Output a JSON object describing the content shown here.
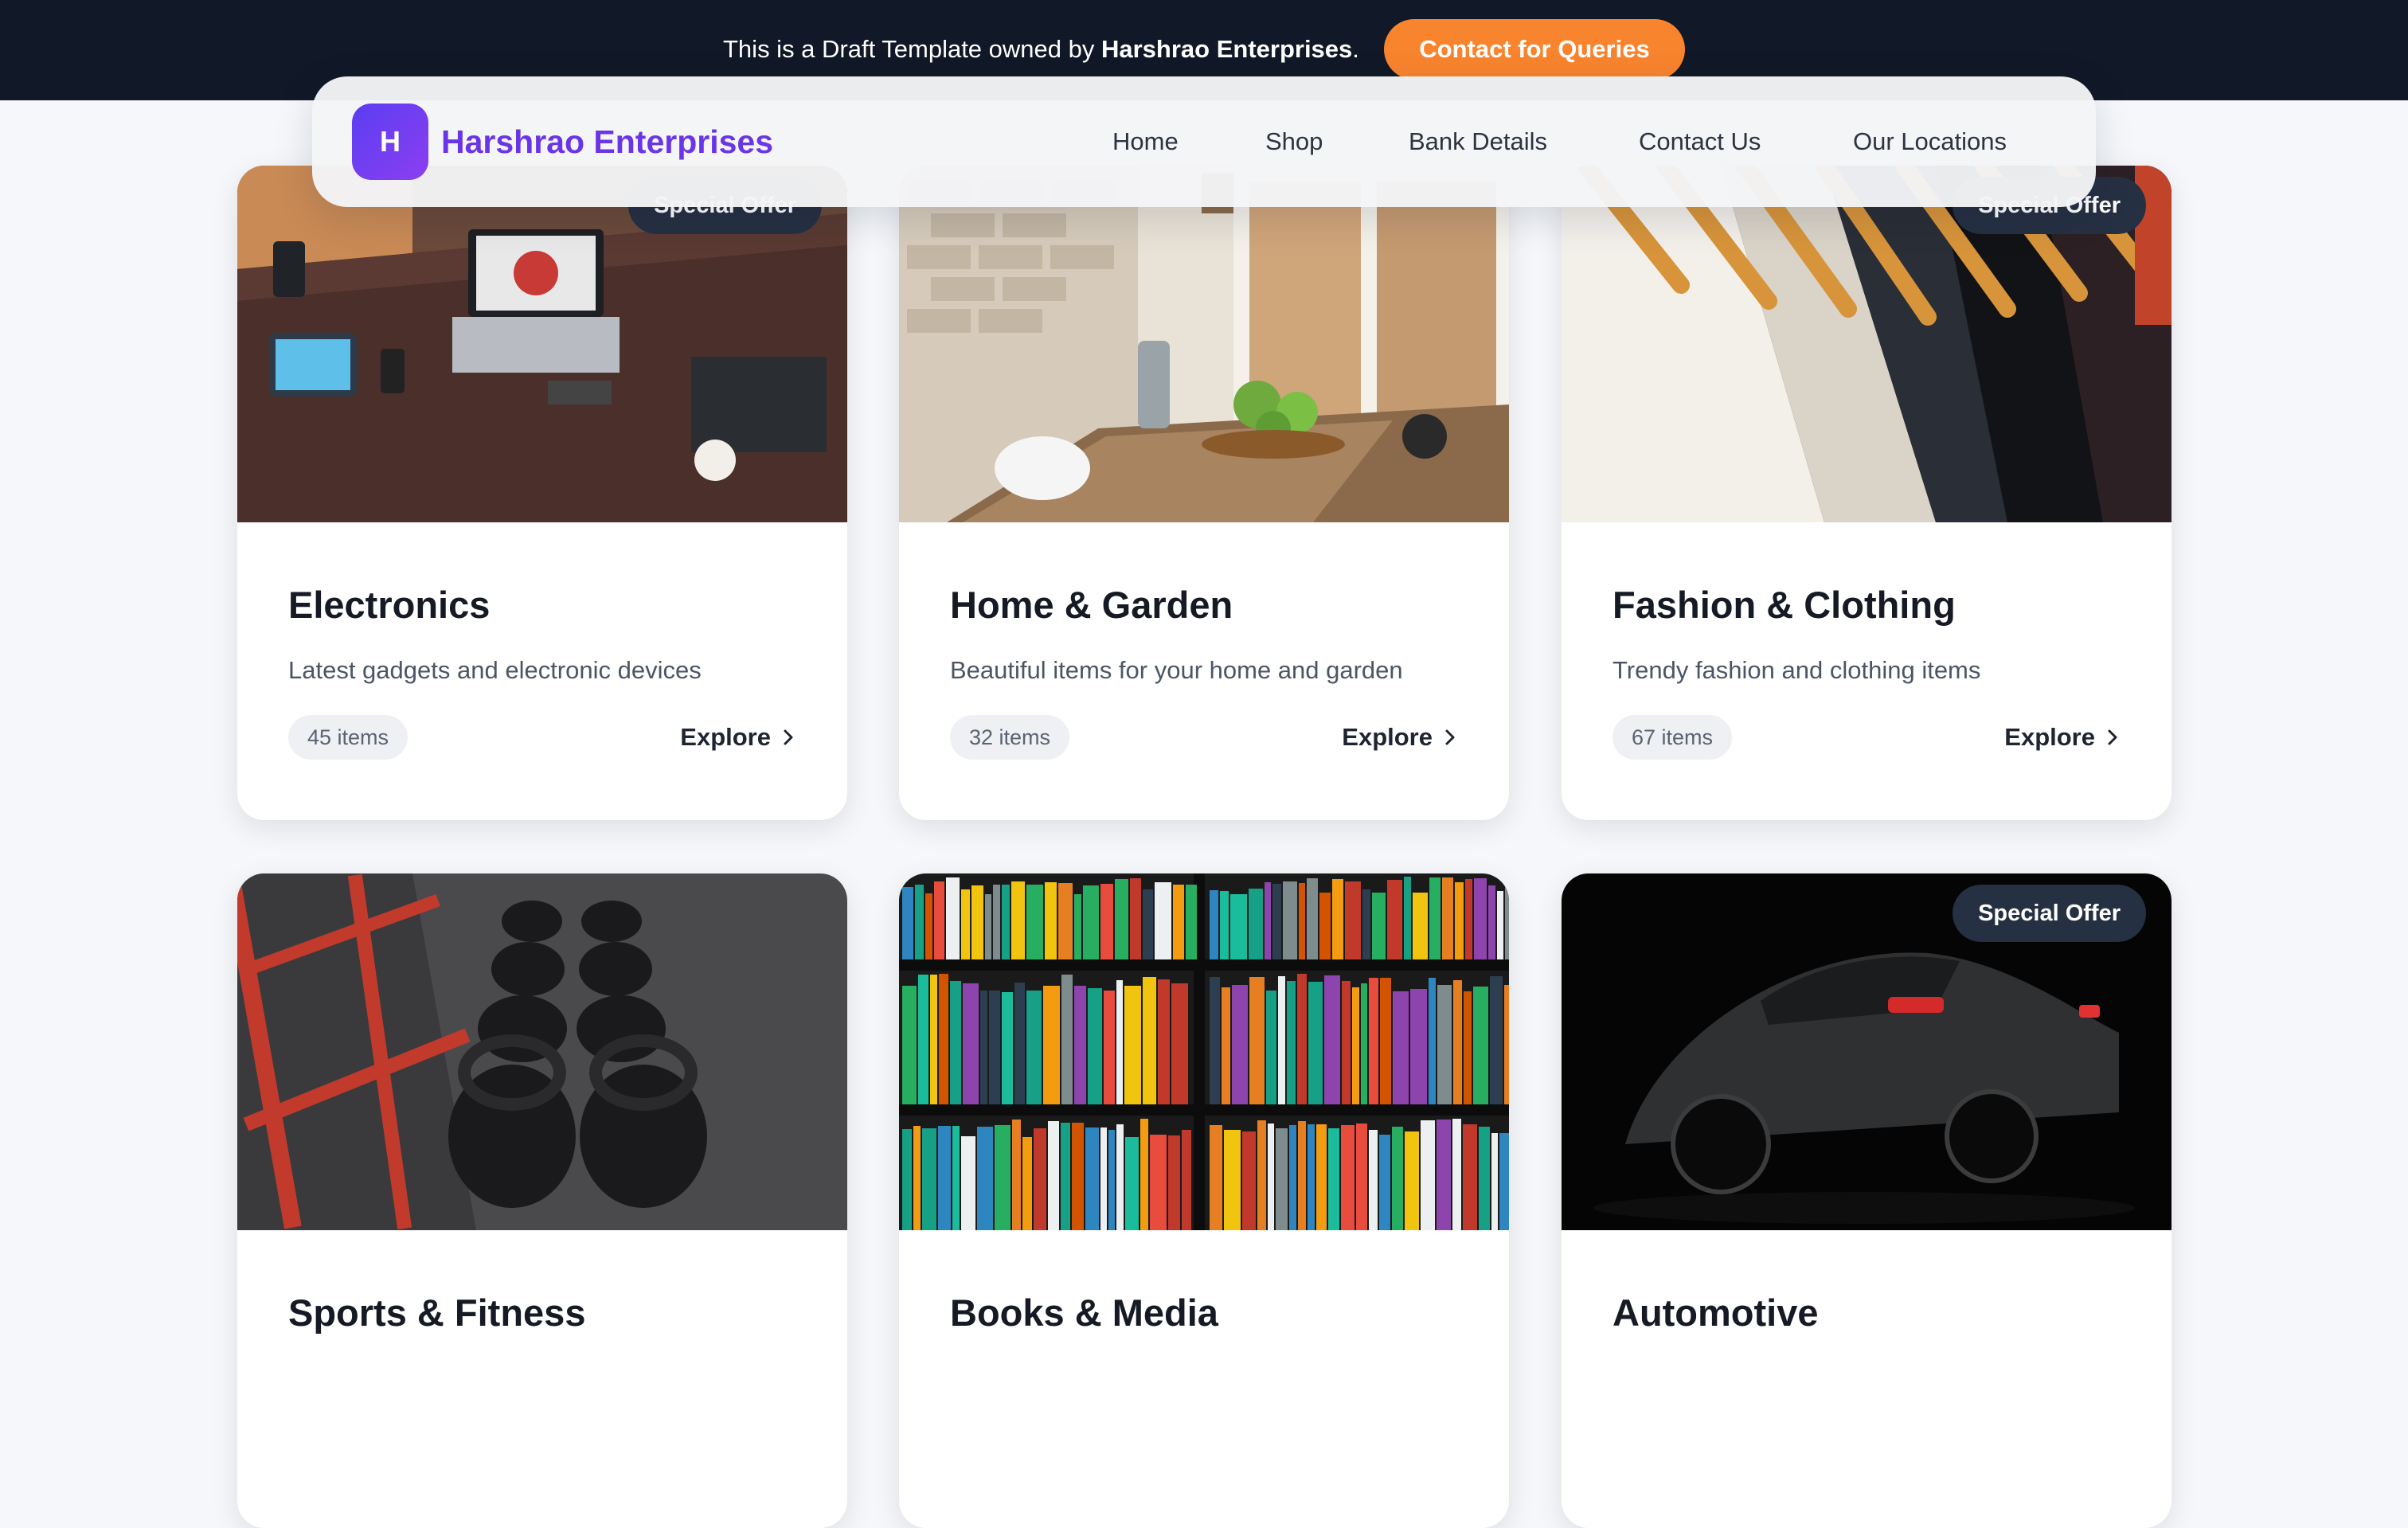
{
  "announcement": {
    "text_before": "This is a Draft Template owned by ",
    "owner": "Harshrao Enterprises",
    "text_after": ".",
    "button_label": "Contact for Queries",
    "button_color": "#f9842e",
    "background_color": "#111827"
  },
  "navbar": {
    "logo_letter": "H",
    "brand_name": "Harshrao Enterprises",
    "brand_color": "#6a35e6",
    "links": [
      {
        "label": "Home"
      },
      {
        "label": "Shop"
      },
      {
        "label": "Bank Details"
      },
      {
        "label": "Contact Us"
      },
      {
        "label": "Our Locations"
      }
    ]
  },
  "categories": [
    {
      "title": "Electronics",
      "description": "Latest gadgets and electronic devices",
      "item_count": "45 items",
      "explore_label": "Explore",
      "badge": "Special Offer",
      "image_icon": "workspace-photo"
    },
    {
      "title": "Home & Garden",
      "description": "Beautiful items for your home and garden",
      "item_count": "32 items",
      "explore_label": "Explore",
      "badge": "",
      "image_icon": "dining-room-photo"
    },
    {
      "title": "Fashion & Clothing",
      "description": "Trendy fashion and clothing items",
      "item_count": "67 items",
      "explore_label": "Explore",
      "badge": "Special Offer",
      "image_icon": "clothes-rack-photo"
    },
    {
      "title": "Sports & Fitness",
      "description": "",
      "item_count": "",
      "explore_label": "",
      "badge": "",
      "image_icon": "kettlebells-photo"
    },
    {
      "title": "Books & Media",
      "description": "",
      "item_count": "",
      "explore_label": "",
      "badge": "",
      "image_icon": "bookshelf-photo"
    },
    {
      "title": "Automotive",
      "description": "",
      "item_count": "",
      "explore_label": "",
      "badge": "Special Offer",
      "image_icon": "sports-car-photo"
    }
  ]
}
